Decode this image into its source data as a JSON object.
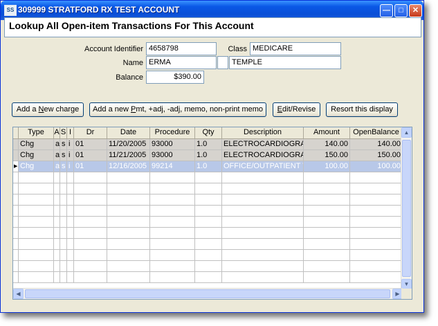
{
  "window": {
    "title": "309999 STRATFORD RX TEST ACCOUNT",
    "icon": "app-icon"
  },
  "heading": "Lookup All Open-item Transactions For This Account",
  "form": {
    "account_identifier_label": "Account Identifier",
    "account_identifier": "4658798",
    "class_label": "Class",
    "class": "MEDICARE",
    "name_label": "Name",
    "first_name": "ERMA",
    "middle_initial": "",
    "last_name": "TEMPLE",
    "balance_label": "Balance",
    "balance": "$390.00"
  },
  "buttons": {
    "add_new_charge": {
      "pre": "Add a ",
      "u": "N",
      "post": "ew charge"
    },
    "add_new_pmt": {
      "pre": "Add a new ",
      "u": "P",
      "post": "mt, +adj, -adj, memo, non-print memo"
    },
    "edit_revise": {
      "pre": "",
      "u": "E",
      "post": "dit/Revise"
    },
    "resort": {
      "pre": "Resort this display",
      "u": "",
      "post": ""
    }
  },
  "grid": {
    "columns": [
      "Type",
      "A",
      "S",
      "I",
      "Dr",
      "Date",
      "Procedure",
      "Qty",
      "Description",
      "Amount",
      "OpenBalance"
    ],
    "rows": [
      {
        "type": "Chg",
        "a": "a",
        "s": "s",
        "i": "i",
        "dr": "01",
        "date": "11/20/2005",
        "procedure": "93000",
        "qty": "1.0",
        "description": "ELECTROCARDIOGRAM",
        "amount": "140.00",
        "open_balance": "140.00"
      },
      {
        "type": "Chg",
        "a": "a",
        "s": "s",
        "i": "i",
        "dr": "01",
        "date": "11/21/2005",
        "procedure": "93000",
        "qty": "1.0",
        "description": "ELECTROCARDIOGRAM",
        "amount": "150.00",
        "open_balance": "150.00"
      },
      {
        "type": "Chg",
        "a": "a",
        "s": "s",
        "i": "i",
        "dr": "01",
        "date": "12/16/2005",
        "procedure": "99214",
        "qty": "1.0",
        "description": "OFFICE/OUTPATIENT V",
        "amount": "100.00",
        "open_balance": "100.00"
      }
    ],
    "selected_row": 2,
    "row_indicator_icon": "row-pointer-icon"
  },
  "colors": {
    "title_bar": "#0a58e6",
    "selected_row": "#b8c8e8",
    "gray_row": "#d6d3ce",
    "window_face": "#ece9d8"
  }
}
